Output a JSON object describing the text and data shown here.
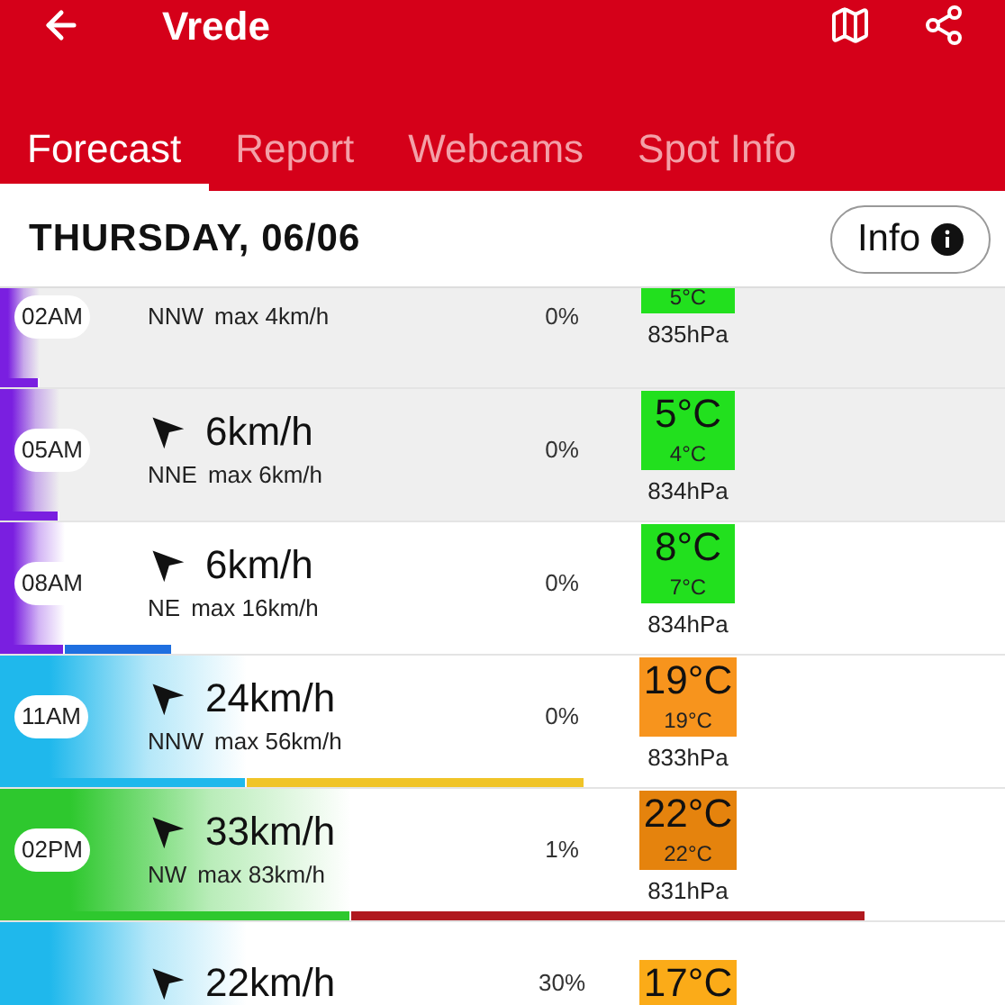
{
  "header": {
    "title": "Vrede"
  },
  "tabs": [
    {
      "label": "Forecast",
      "selected": true
    },
    {
      "label": "Report",
      "selected": false
    },
    {
      "label": "Webcams",
      "selected": false
    },
    {
      "label": "Spot Info",
      "selected": false
    }
  ],
  "day": {
    "title": "THURSDAY, 06/06",
    "info_button": "Info"
  },
  "rows": [
    {
      "time": "02AM",
      "night": true,
      "direction": "NNW",
      "max": "max 4km/h",
      "rain": "0%",
      "temp": {
        "feel": "5°C",
        "color": "#22e01e"
      },
      "pressure": "835hPa",
      "wind_bar": {
        "color": "#7a1fe0",
        "level": 0.04
      }
    },
    {
      "time": "05AM",
      "night": true,
      "speed": "6km/h",
      "direction": "NNE",
      "max": "max 6km/h",
      "rain": "0%",
      "temp": {
        "value": "5°C",
        "feel": "4°C",
        "color": "#22e01e"
      },
      "pressure": "834hPa",
      "wind_bar": {
        "color": "#7a1fe0",
        "level": 0.06
      }
    },
    {
      "time": "08AM",
      "night": false,
      "speed": "6km/h",
      "direction": "NE",
      "max": "max 16km/h",
      "rain": "0%",
      "temp": {
        "value": "8°C",
        "feel": "7°C",
        "color": "#22e01e"
      },
      "pressure": "834hPa",
      "wind_bar": {
        "color": "#7a1fe0",
        "level": 0.065
      },
      "gust_bar": {
        "color": "#1f6fe0",
        "level": 0.17
      }
    },
    {
      "time": "11AM",
      "night": false,
      "speed": "24km/h",
      "direction": "NNW",
      "max": "max 56km/h",
      "rain": "0%",
      "temp": {
        "value": "19°C",
        "feel": "19°C",
        "color": "#f7941d"
      },
      "pressure": "833hPa",
      "wind_bar": {
        "color": "#1fb8ec",
        "level": 0.245
      },
      "gust_bar": {
        "color": "#f0c428",
        "level": 0.58
      }
    },
    {
      "time": "02PM",
      "night": false,
      "speed": "33km/h",
      "direction": "NW",
      "max": "max 83km/h",
      "rain": "1%",
      "temp": {
        "value": "22°C",
        "feel": "22°C",
        "color": "#e5830d"
      },
      "pressure": "831hPa",
      "wind_bar": {
        "color": "#2ec82e",
        "level": 0.35
      },
      "gust_bar": {
        "color": "#b0181e",
        "level": 0.86
      }
    },
    {
      "night": false,
      "speed": "22km/h",
      "rain": "30%",
      "temp": {
        "value": "17°C",
        "color": "#fbab18"
      },
      "wind_bar": {
        "color": "#1fb8ec",
        "level": 0.245
      }
    }
  ]
}
